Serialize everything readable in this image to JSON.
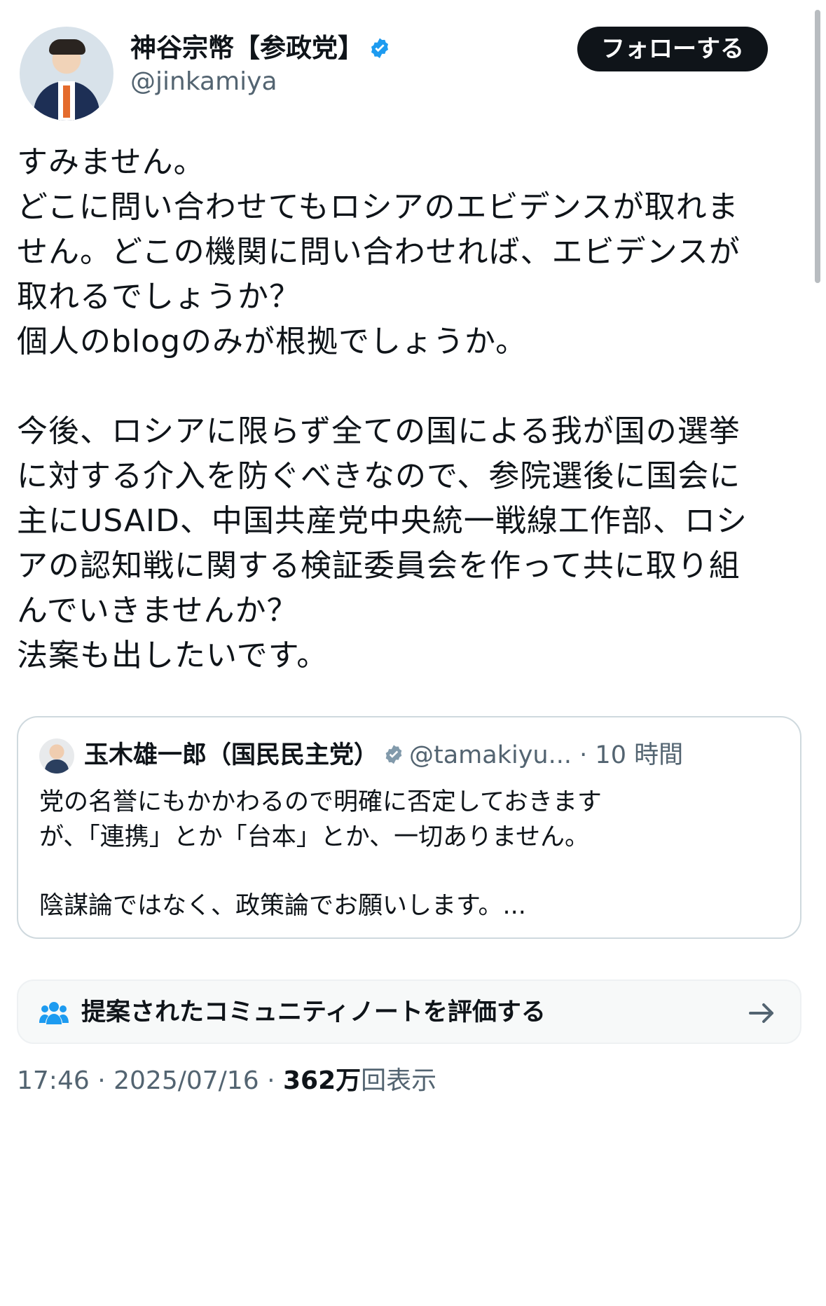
{
  "author": {
    "name": "神谷宗幣【参政党】",
    "handle": "@jinkamiya",
    "follow_label": "フォローする"
  },
  "tweet": {
    "lines": [
      "すみません。",
      "どこに問い合わせてもロシアのエビデンスが取れま",
      "せん。どこの機関に問い合わせれば、エビデンスが",
      "取れるでしょうか？",
      "個人のblogのみが根拠でしょうか。",
      "",
      "今後、ロシアに限らず全ての国による我が国の選挙",
      "に対する介入を防ぐべきなので、参院選後に国会に",
      "主にUSAID、中国共産党中央統一戦線工作部、ロシ",
      "アの認知戦に関する検証委員会を作って共に取り組",
      "んでいきませんか？",
      "法案も出したいです。"
    ]
  },
  "quote": {
    "author_name": "玉木雄一郎（国民民主党）",
    "author_handle": "@tamakiyu...",
    "time_separator": "·",
    "time": "10 時間",
    "line1": "党の名誉にもかかわるので明確に否定しておきます",
    "line2": "が、「連携」とか「台本」とか、一切ありません。",
    "line3": "陰謀論ではなく、政策論でお願いします。..."
  },
  "community_note": {
    "label": "提案されたコミュニティノートを評価する"
  },
  "footer": {
    "time": "17:46",
    "separator": "·",
    "date": "2025/07/16",
    "views_count": "362万",
    "views_label": "回表示"
  },
  "colors": {
    "verified": "#1d9bf0",
    "secondary_text": "#536471",
    "follow_button": "#0f1419",
    "community_icon": "#1d9bf0"
  },
  "icons": {
    "verified": "verified-badge-icon",
    "community": "community-notes-icon",
    "arrow": "arrow-right-icon"
  }
}
